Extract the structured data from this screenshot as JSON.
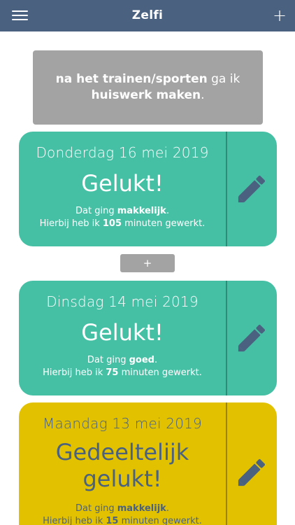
{
  "header": {
    "title": "Zelfi",
    "menu_icon": "hamburger-menu-icon",
    "add_label": "+"
  },
  "goal": {
    "part1": "na het trainen/sporten",
    "part2": " ga ik ",
    "part3": "huiswerk maken",
    "part4": "."
  },
  "entries": [
    {
      "date": "Donderdag 16 mei 2019",
      "result": "Gelukt!",
      "line1_pre": "Dat ging ",
      "ease": "makkelijk",
      "line1_post": ".",
      "line2_pre": "Hierbij heb ik ",
      "minutes": "105",
      "line2_post": " minuten gewerkt.",
      "color": "#45c0a4",
      "edit_icon": "pencil-icon"
    },
    {
      "date": "Dinsdag 14 mei 2019",
      "result": "Gelukt!",
      "line1_pre": "Dat ging ",
      "ease": "goed",
      "line1_post": ".",
      "line2_pre": "Hierbij heb ik ",
      "minutes": "75",
      "line2_post": " minuten gewerkt.",
      "color": "#45c0a4",
      "edit_icon": "pencil-icon"
    },
    {
      "date": "Maandag 13 mei 2019",
      "result_line1": "Gedeeltelijk",
      "result_line2": "gelukt!",
      "line1_pre": "Dat ging ",
      "ease": "makkelijk",
      "line1_post": ".",
      "line2_pre": "Hierbij heb ik ",
      "minutes": "15",
      "line2_post": " minuten gewerkt.",
      "color": "#e2c200",
      "edit_icon": "pencil-icon"
    }
  ],
  "insert_label": "+",
  "colors": {
    "header": "#4a6280",
    "goal_box": "#a3a3a3",
    "success": "#45c0a4",
    "partial": "#e2c200",
    "text_dark": "#4a6280"
  }
}
